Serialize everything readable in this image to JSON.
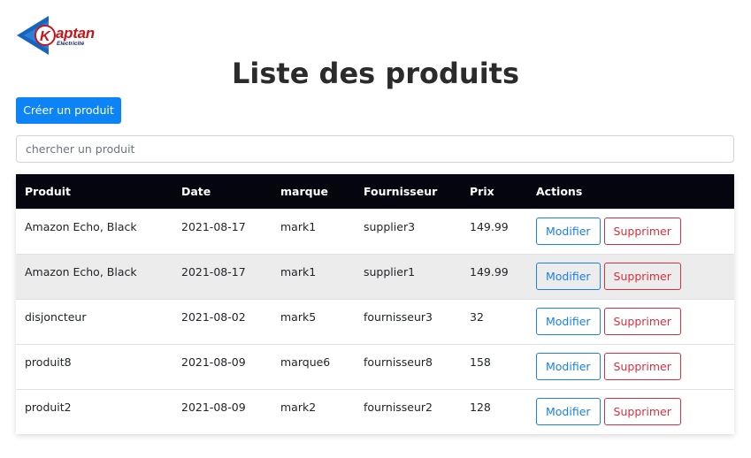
{
  "logo": {
    "word": "aptan",
    "letter": "K",
    "sub": "Electricité",
    "colors": {
      "blue": "#1565c0",
      "red": "#c8151b"
    }
  },
  "page": {
    "title": "Liste des produits"
  },
  "toolbar": {
    "create_label": "Créer un produit"
  },
  "search": {
    "placeholder": "chercher un produit",
    "value": ""
  },
  "table": {
    "headers": [
      "Produit",
      "Date",
      "marque",
      "Fournisseur",
      "Prix",
      "Actions"
    ],
    "rows": [
      {
        "produit": "Amazon Echo, Black",
        "date": "2021-08-17",
        "marque": "mark1",
        "fournisseur": "supplier3",
        "prix": "149.99"
      },
      {
        "produit": "Amazon Echo, Black",
        "date": "2021-08-17",
        "marque": "mark1",
        "fournisseur": "supplier1",
        "prix": "149.99"
      },
      {
        "produit": "disjoncteur",
        "date": "2021-08-02",
        "marque": "mark5",
        "fournisseur": "fournisseur3",
        "prix": "32"
      },
      {
        "produit": "produit8",
        "date": "2021-08-09",
        "marque": "marque6",
        "fournisseur": "fournisseur8",
        "prix": "158"
      },
      {
        "produit": "produit2",
        "date": "2021-08-09",
        "marque": "mark2",
        "fournisseur": "fournisseur2",
        "prix": "128"
      }
    ],
    "edit_label": "Modifier",
    "delete_label": "Supprimer"
  },
  "colors": {
    "primary": "#0d84f5",
    "header_bg": "#05050f",
    "danger": "#d63040",
    "info": "#1a7fe8"
  }
}
